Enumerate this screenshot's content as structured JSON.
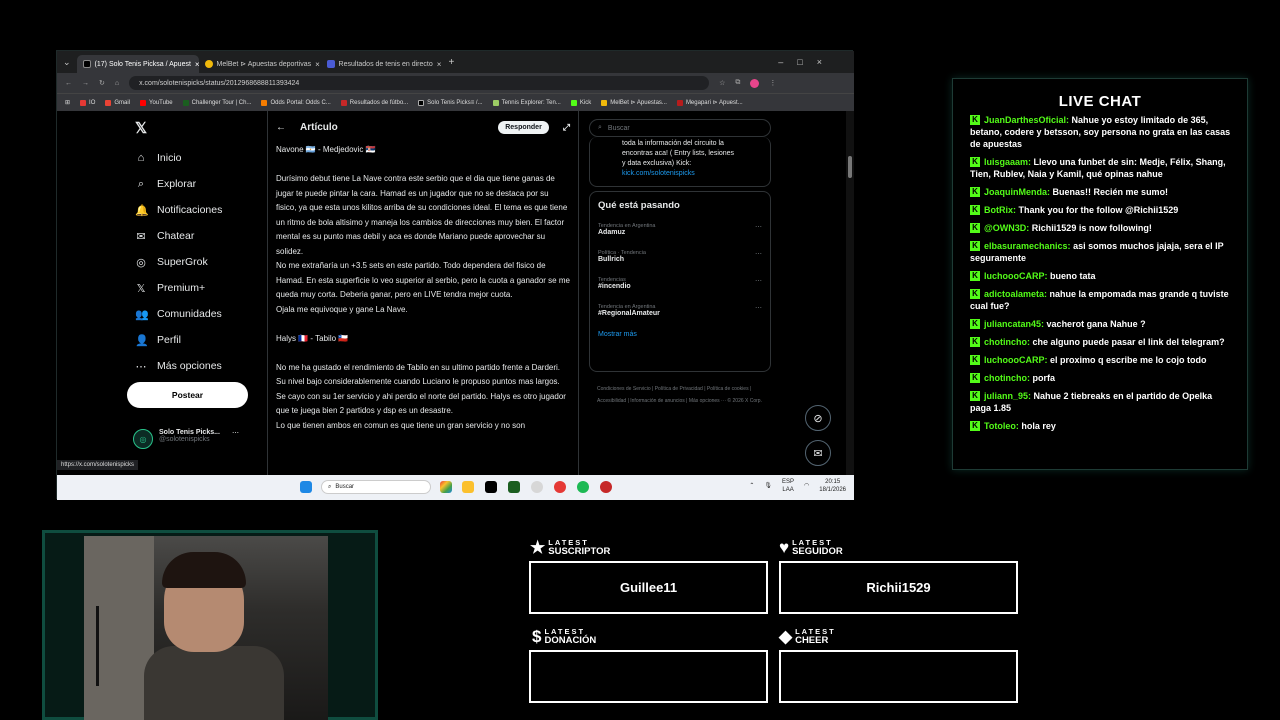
{
  "browser": {
    "tabs": [
      {
        "label": "(17) Solo Tenis Picksa / Apuest",
        "color": "#fff",
        "active": true
      },
      {
        "label": "MelBet ⊳ Apuestas deportivas",
        "color": "#f0b90b",
        "active": false
      },
      {
        "label": "Resultados de tenis en directo",
        "color": "#4a5bd4",
        "active": false
      }
    ],
    "url": "x.com/solotenispicks/status/2012968688811393424",
    "bookmarks": [
      "IO",
      "Gmail",
      "YouTube",
      "Challenger Tour | Ch...",
      "Odds Portal: Odds C...",
      "Resultados de fútbo...",
      "Solo Tenis Picks≡ /...",
      "Tennis Explorer: Ten...",
      "Kick",
      "MelBet ⊳ Apuestas...",
      "Megapari ⊳ Apuest..."
    ]
  },
  "nav": {
    "items": [
      {
        "label": "Inicio",
        "icon": "home-icon",
        "glyph": "⌂"
      },
      {
        "label": "Explorar",
        "icon": "search-icon",
        "glyph": "⌕"
      },
      {
        "label": "Notificaciones",
        "icon": "bell-icon",
        "glyph": "🔔"
      },
      {
        "label": "Chatear",
        "icon": "mail-icon",
        "glyph": "✉"
      },
      {
        "label": "SuperGrok",
        "icon": "grok-icon",
        "glyph": "◎"
      },
      {
        "label": "Premium+",
        "icon": "x-icon",
        "glyph": "𝕏"
      },
      {
        "label": "Comunidades",
        "icon": "people-icon",
        "glyph": "👥"
      },
      {
        "label": "Perfil",
        "icon": "person-icon",
        "glyph": "👤"
      },
      {
        "label": "Más opciones",
        "icon": "more-icon",
        "glyph": "⋯"
      }
    ],
    "post_label": "Postear",
    "profile_name": "Solo Tenis Picks...",
    "profile_handle": "@solotenispicks",
    "notif_count": "17"
  },
  "article": {
    "title": "Artículo",
    "reply_label": "Responder",
    "paragraphs": [
      "Navone 🇦🇷 - Medjedovic 🇷🇸",
      "Durísimo debut tiene La Nave contra este serbio que el dia que tiene ganas de jugar te puede pintar la cara. Hamad es un jugador que no se destaca por su fisico, ya que esta unos kilitos arriba de su condiciones ideal. El tema es que tiene un ritmo de bola altisimo y maneja los cambios de direcciones muy bien. El factor mental es su punto mas debil y aca es donde Mariano puede aprovechar su solidez.\nNo me extrañaría un +3.5 sets en este partido. Todo dependera del fisico de Hamad. En esta superficie lo veo superior al serbio, pero la cuota a ganador se me queda muy corta. Deberia ganar, pero en LIVE tendra mejor cuota.\nOjala me equivoque y gane La Nave.",
      "Halys 🇫🇷 - Tabilo 🇨🇱",
      "No me ha gustado el rendimiento de Tabilo en su ultimo partido frente a Darderi. Su nivel bajo considerablemente cuando Luciano le propuso puntos mas largos. Se cayo con su 1er servicio y ahi perdio el norte del partido. Halys es otro jugador que te juega bien 2 partidos y dsp es un desastre.\nLo que tienen ambos en comun es que tiene un gran servicio y no son"
    ]
  },
  "right": {
    "search_placeholder": "Buscar",
    "about_text": "toda la información del circuito la encontras aca! ( Entry lists, lesiones y data exclusiva) Kick:",
    "about_link": "kick.com/solotenispicks",
    "whats_title": "Qué está pasando",
    "trends": [
      {
        "ctx": "Tendencia en Argentina",
        "name": "Adamuz"
      },
      {
        "ctx": "Política · Tendencia",
        "name": "Bullrich"
      },
      {
        "ctx": "Tendencias",
        "name": "#incendio"
      },
      {
        "ctx": "Tendencia en Argentina",
        "name": "#RegionalAmateur"
      }
    ],
    "more_label": "Mostrar más",
    "footer": "Condiciones de Servicio | Política de Privacidad | Política de cookies | Accesibilidad | Información de anuncios | Más opciones ··· © 2026 X Corp."
  },
  "status_url": "https://x.com/solotenispicks",
  "taskbar": {
    "search": "Buscar",
    "lang_top": "ESP",
    "lang_bot": "LAA",
    "time": "20:15",
    "date": "18/1/2026"
  },
  "chat": {
    "title": "LIVE CHAT",
    "messages": [
      {
        "user": "JuanDarthesOficial:",
        "text": "Nahue yo estoy limitado de 365, betano, codere y betsson, soy persona no grata en las casas de apuestas"
      },
      {
        "user": "luisgaaam:",
        "text": "Llevo una funbet de sin: Medje, Félix, Shang, Tien, Rublev, Naia y Kamil, qué opinas nahue"
      },
      {
        "user": "JoaquinMenda:",
        "text": "Buenas!! Recién me sumo!"
      },
      {
        "user": "BotRix:",
        "text": "Thank you for the follow @Richii1529"
      },
      {
        "user": "@OWN3D:",
        "text": "Richii1529 is now following!"
      },
      {
        "user": "elbasuramechanics:",
        "text": "asi somos muchos jajaja, sera el IP seguramente"
      },
      {
        "user": "luchoooCARP:",
        "text": "bueno tata"
      },
      {
        "user": "adictoalameta:",
        "text": "nahue la empomada mas grande q tuviste cual fue?"
      },
      {
        "user": "juliancatan45:",
        "text": "vacherot gana Nahue ?"
      },
      {
        "user": "chotincho:",
        "text": "che alguno puede pasar el link del telegram?"
      },
      {
        "user": "luchoooCARP:",
        "text": "el proximo q escribe me lo cojo todo"
      },
      {
        "user": "chotincho:",
        "text": "porfa"
      },
      {
        "user": "juliann_95:",
        "text": "Nahue 2 tiebreaks en el partido de Opelka paga 1.85"
      },
      {
        "user": "Totoleo:",
        "text": "hola rey"
      }
    ]
  },
  "alerts": {
    "latest_word": "LATEST",
    "suscriptor": {
      "label": "SUSCRIPTOR",
      "value": "Guillee11"
    },
    "seguidor": {
      "label": "SEGUIDOR",
      "value": "Richii1529"
    },
    "donacion": {
      "label": "DONACIÓN",
      "value": ""
    },
    "cheer": {
      "label": "CHEER",
      "value": ""
    }
  },
  "colors": {
    "kick_green": "#53fc18",
    "x_blue": "#1d9bf0",
    "frame_green": "#0f4d3f"
  }
}
